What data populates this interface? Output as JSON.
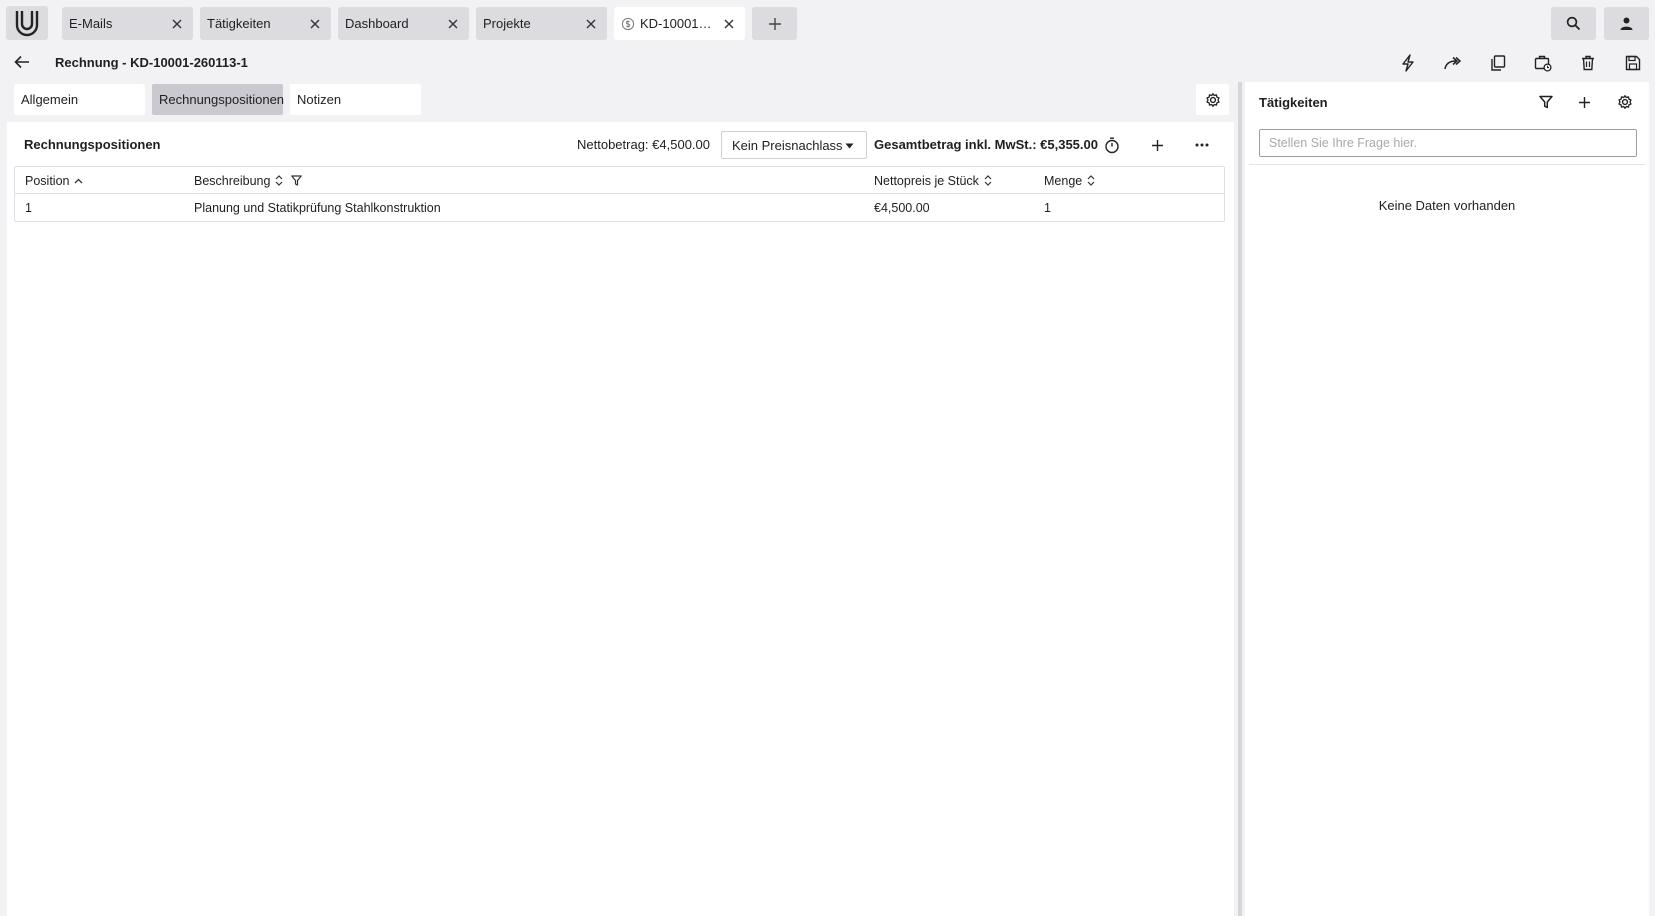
{
  "tabs": [
    {
      "label": "E-Mails",
      "active": false
    },
    {
      "label": "Tätigkeiten",
      "active": false
    },
    {
      "label": "Dashboard",
      "active": false
    },
    {
      "label": "Projekte",
      "active": false
    },
    {
      "label": "KD-10001-26...",
      "active": true,
      "icon": "dollar-circle-icon"
    }
  ],
  "header": {
    "title": "Rechnung - KD-10001-260113-1"
  },
  "subtabs": [
    {
      "label": "Allgemein",
      "active": false
    },
    {
      "label": "Rechnungspositionen",
      "active": true
    },
    {
      "label": "Notizen",
      "active": false
    }
  ],
  "section": {
    "title": "Rechnungspositionen",
    "netto": "Nettobetrag: €4,500.00",
    "discount_selected": "Kein Preisnachlass",
    "gesamt": "Gesamtbetrag inkl. MwSt.: €5,355.00"
  },
  "table": {
    "columns": [
      "Position",
      "Beschreibung",
      "Nettopreis je Stück",
      "Menge"
    ],
    "rows": [
      {
        "position": "1",
        "beschreibung": "Planung und Statikprüfung Stahlkonstruktion",
        "nettopreis": "€4,500.00",
        "menge": "1"
      }
    ]
  },
  "activities": {
    "title": "Tätigkeiten",
    "search_placeholder": "Stellen Sie Ihre Frage hier.",
    "empty_text": "Keine Daten vorhanden"
  },
  "colors": {
    "background": "#f2f2f4",
    "tab_inactive": "#dcdce0",
    "subtab_active": "#c9c9cf",
    "panel": "#ffffff"
  }
}
